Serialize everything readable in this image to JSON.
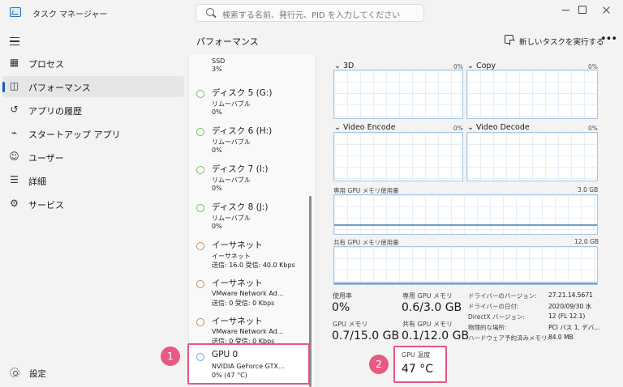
{
  "window": {
    "title": "タスク マネージャー",
    "search_placeholder": "検索する名前、発行元、PID を入力してください"
  },
  "nav": {
    "items": [
      {
        "label": "プロセス",
        "icon": "processes-icon"
      },
      {
        "label": "パフォーマンス",
        "icon": "performance-icon",
        "active": true
      },
      {
        "label": "アプリの履歴",
        "icon": "app-history-icon"
      },
      {
        "label": "スタートアップ アプリ",
        "icon": "startup-icon"
      },
      {
        "label": "ユーザー",
        "icon": "users-icon"
      },
      {
        "label": "詳細",
        "icon": "details-icon"
      },
      {
        "label": "サービス",
        "icon": "services-icon"
      }
    ],
    "settings_label": "設定"
  },
  "header": {
    "title": "パフォーマンス",
    "new_task_label": "新しいタスクを実行する",
    "more": "•••"
  },
  "devices": {
    "partial_top": {
      "name": "SSD",
      "value": "3%"
    },
    "items": [
      {
        "name": "ディスク 5 (G:)",
        "sub": "リムーバブル",
        "value": "0%",
        "kind": "disk"
      },
      {
        "name": "ディスク 6 (H:)",
        "sub": "リムーバブル",
        "value": "0%",
        "kind": "disk"
      },
      {
        "name": "ディスク 7 (I:)",
        "sub": "リムーバブル",
        "value": "0%",
        "kind": "disk"
      },
      {
        "name": "ディスク 8 (J:)",
        "sub": "リムーバブル",
        "value": "0%",
        "kind": "disk"
      },
      {
        "name": "イーサネット",
        "sub": "イーサネット",
        "value": "送信: 16.0 受信: 40.0 Kbps",
        "kind": "ethernet"
      },
      {
        "name": "イーサネット",
        "sub": "VMware Network Ad...",
        "value": "送信: 0 受信: 0 Kbps",
        "kind": "ethernet"
      },
      {
        "name": "イーサネット",
        "sub": "VMware Network Ad...",
        "value": "送信: 0 受信: 0 Kbps",
        "kind": "ethernet"
      },
      {
        "name": "GPU 0",
        "sub": "NVIDIA GeForce GTX...",
        "value": "0% (47 °C)",
        "kind": "gpu",
        "selected": true
      }
    ]
  },
  "markers": {
    "one": "1",
    "two": "2"
  },
  "graphs": {
    "engines": [
      {
        "label": "3D",
        "pct": "0%"
      },
      {
        "label": "Copy",
        "pct": "0%"
      },
      {
        "label": "Video Encode",
        "pct": "0%"
      },
      {
        "label": "Video Decode",
        "pct": "0%"
      }
    ],
    "dedicated": {
      "label": "専用 GPU メモリ使用量",
      "max": "3.0 GB",
      "usage_fraction": 0.2
    },
    "shared": {
      "label": "共有 GPU メモリ使用量",
      "max": "12.0 GB",
      "usage_fraction": 0.0
    }
  },
  "stats": {
    "utilization": {
      "label": "使用率",
      "value": "0%"
    },
    "dedicated_mem": {
      "label": "専用 GPU メモリ",
      "value": "0.6/3.0 GB"
    },
    "gpu_mem": {
      "label": "GPU メモリ",
      "value": "0.7/15.0 GB"
    },
    "shared_mem": {
      "label": "共有 GPU メモリ",
      "value": "0.1/12.0 GB"
    },
    "temperature": {
      "label": "GPU 温度",
      "value": "47 °C"
    }
  },
  "info": [
    {
      "key": "ドライバーのバージョン:",
      "value": "27.21.14.5671"
    },
    {
      "key": "ドライバーの日付:",
      "value": "2020/09/30 水"
    },
    {
      "key": "DirectX バージョン:",
      "value": "12 (FL 12.1)"
    },
    {
      "key": "物理的な場所:",
      "value": "PCI バス 1, デバ..."
    },
    {
      "key": "ハードウェア予約済みメモリ:",
      "value": "84.0 MB"
    }
  ]
}
